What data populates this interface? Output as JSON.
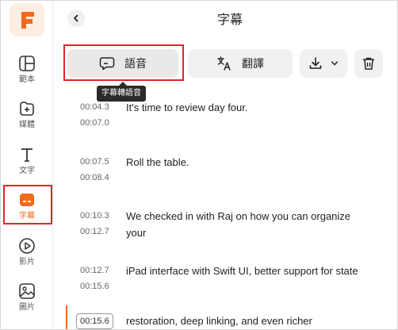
{
  "app": {
    "title": "字幕"
  },
  "sidebar": {
    "items": [
      {
        "label": "範本",
        "icon": "template-icon"
      },
      {
        "label": "媒體",
        "icon": "add-media-icon"
      },
      {
        "label": "文字",
        "icon": "text-icon"
      },
      {
        "label": "字幕",
        "icon": "subtitles-icon",
        "active": true
      },
      {
        "label": "影片",
        "icon": "video-icon"
      },
      {
        "label": "圖片",
        "icon": "image-icon"
      }
    ]
  },
  "toolbar": {
    "speech_label": "語音",
    "translate_label": "翻譯",
    "tooltip": "字幕轉語音"
  },
  "subtitles": [
    {
      "start": "00:04.3",
      "end": "00:07.0",
      "text": "It's time to review day four."
    },
    {
      "start": "00:07.5",
      "end": "00:08.4",
      "text": "Roll the table."
    },
    {
      "start": "00:10.3",
      "end": "00:12.7",
      "text": "We checked in with Raj on how you can organize your"
    },
    {
      "start": "00:12.7",
      "end": "00:15.6",
      "text": "iPad interface with Swift UI, better support for state"
    },
    {
      "start": "00:15.6",
      "text": "restoration, deep linking, and even richer"
    }
  ],
  "colors": {
    "accent": "#f26a1b",
    "highlight": "#e0242b"
  }
}
